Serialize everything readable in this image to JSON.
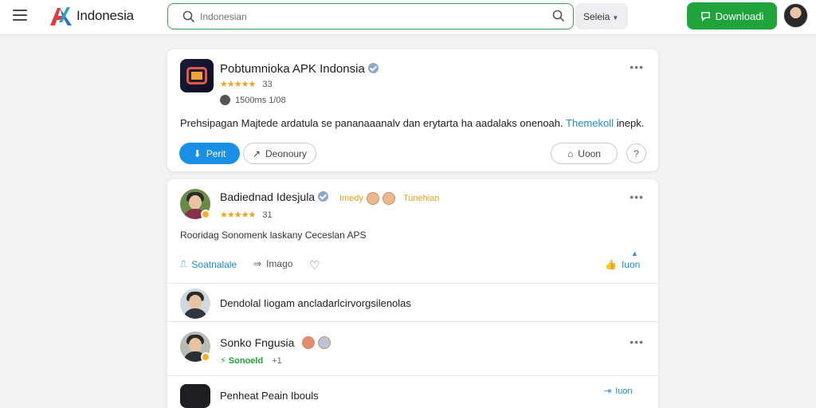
{
  "header": {
    "brand": "Indonesia",
    "search_placeholder": "Indonesian",
    "lang": "Seleia",
    "download_label": "Downloadi"
  },
  "post1": {
    "title": "Pobtumnioka APK Indonsia",
    "rating": "33",
    "meta": "1500ms 1/08",
    "desc_main": "Prehsipagan Majtede ardatula se pananaaanalv dan erytarta ha aadalaks onenoah.",
    "desc_link": "Themekoll",
    "desc_tail": "inepk.",
    "btn_primary": "Perit",
    "btn_secondary": "Deonoury",
    "btn_right": "Uoon",
    "more": "•••"
  },
  "post2": {
    "title": "Badiednad Idesjula",
    "tag_left": "Imedy",
    "tag_right": "Tunehian",
    "rating": "31",
    "desc": "Rooridag Sonomenk laskany Ceceslan APS",
    "report_label": "Soatnalale",
    "share_label": "Imago",
    "like_label": "Iuon",
    "more": "•••"
  },
  "comments": [
    {
      "text": "Dendolal Iiogam ancladarlcirvorgsilenolas"
    },
    {
      "title": "Sonko Fngusia",
      "tag": "Sonoeld",
      "count": "+1",
      "more": "•••"
    },
    {
      "text": "Penheat Peain Ibouls",
      "reply": "Iuon"
    }
  ]
}
